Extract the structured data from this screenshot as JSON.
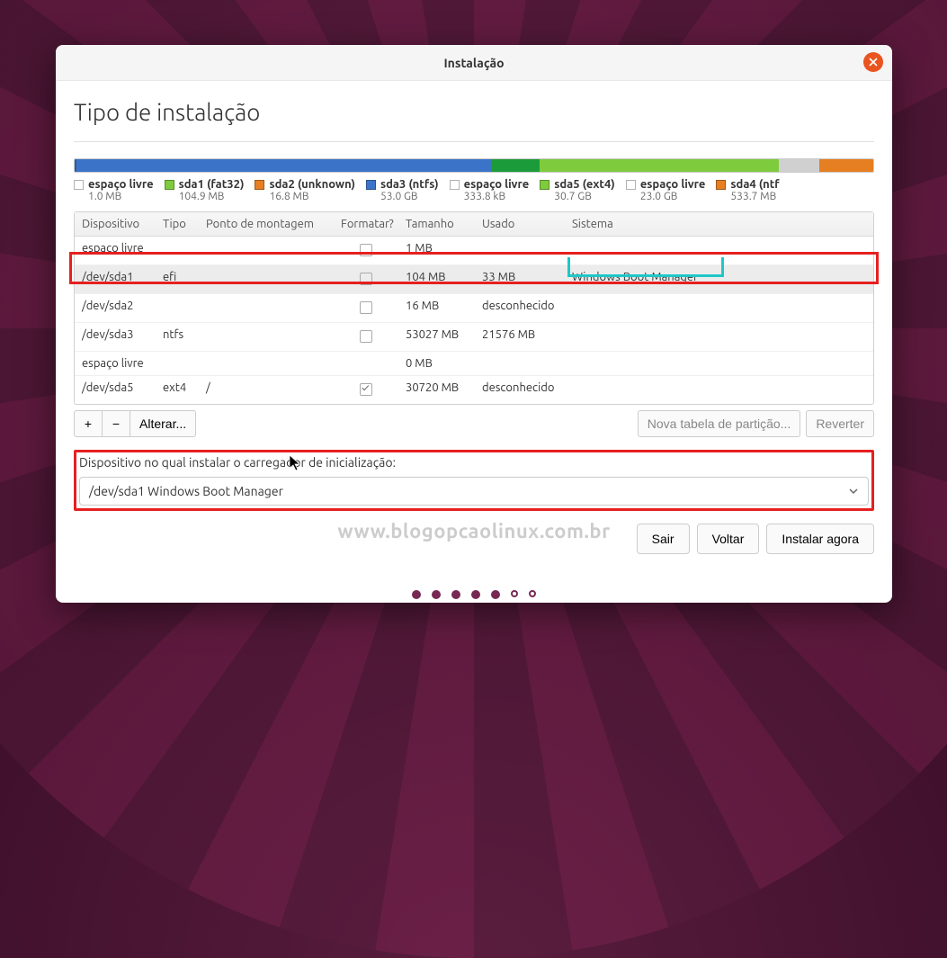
{
  "window": {
    "title": "Instalação"
  },
  "page": {
    "title": "Tipo de instalação"
  },
  "diskbar": [
    {
      "color": "#2e5c9a",
      "pct": 0.2
    },
    {
      "color": "#3b73c9",
      "pct": 52.0
    },
    {
      "color": "#1b9b3a",
      "pct": 6.0
    },
    {
      "color": "#7ecb3e",
      "pct": 30.0
    },
    {
      "color": "#d0d0d0",
      "pct": 5.0
    },
    {
      "color": "#e67e22",
      "pct": 6.8
    }
  ],
  "legend": [
    {
      "color": "#ffffff",
      "label": "espaço livre",
      "size": "1.0 MB"
    },
    {
      "color": "#7ecb3e",
      "label": "sda1 (fat32)",
      "size": "104.9 MB"
    },
    {
      "color": "#e67e22",
      "label": "sda2 (unknown)",
      "size": "16.8 MB"
    },
    {
      "color": "#3b73c9",
      "label": "sda3 (ntfs)",
      "size": "53.0 GB"
    },
    {
      "color": "#ffffff",
      "label": "espaço livre",
      "size": "333.8 kB"
    },
    {
      "color": "#7ecb3e",
      "label": "sda5 (ext4)",
      "size": "30.7 GB"
    },
    {
      "color": "#ffffff",
      "label": "espaço livre",
      "size": "23.0 GB"
    },
    {
      "color": "#e67e22",
      "label": "sda4 (ntf",
      "size": "533.7 MB"
    }
  ],
  "table": {
    "headers": {
      "device": "Dispositivo",
      "type": "Tipo",
      "mount": "Ponto de montagem",
      "format": "Formatar?",
      "size": "Tamanho",
      "used": "Usado",
      "system": "Sistema"
    },
    "rows": [
      {
        "device": "espaço livre",
        "type": "",
        "mount": "",
        "format": false,
        "hasFmt": true,
        "size": "1 MB",
        "used": "",
        "system": ""
      },
      {
        "device": "/dev/sda1",
        "type": "efi",
        "mount": "",
        "format": false,
        "hasFmt": true,
        "size": "104 MB",
        "used": "33 MB",
        "system": "Windows Boot Manager",
        "selected": true
      },
      {
        "device": "/dev/sda2",
        "type": "",
        "mount": "",
        "format": false,
        "hasFmt": true,
        "size": "16 MB",
        "used": "desconhecido",
        "system": ""
      },
      {
        "device": "/dev/sda3",
        "type": "ntfs",
        "mount": "",
        "format": false,
        "hasFmt": true,
        "size": "53027 MB",
        "used": "21576 MB",
        "system": ""
      },
      {
        "device": "espaço livre",
        "type": "",
        "mount": "",
        "format": false,
        "hasFmt": false,
        "size": "0 MB",
        "used": "",
        "system": ""
      },
      {
        "device": "/dev/sda5",
        "type": "ext4",
        "mount": "/",
        "format": true,
        "hasFmt": true,
        "size": "30720 MB",
        "used": "desconhecido",
        "system": ""
      }
    ]
  },
  "toolbar": {
    "plus": "+",
    "minus": "−",
    "change": "Alterar...",
    "newtable": "Nova tabela de partição...",
    "revert": "Reverter"
  },
  "bootloader": {
    "label": "Dispositivo no qual instalar o carregador de inicialização:",
    "value": "/dev/sda1 Windows Boot Manager"
  },
  "actions": {
    "quit": "Sair",
    "back": "Voltar",
    "install": "Instalar agora"
  },
  "watermark": "www.blogopcaolinux.com.br",
  "progress": {
    "filled": 5,
    "total": 7
  }
}
